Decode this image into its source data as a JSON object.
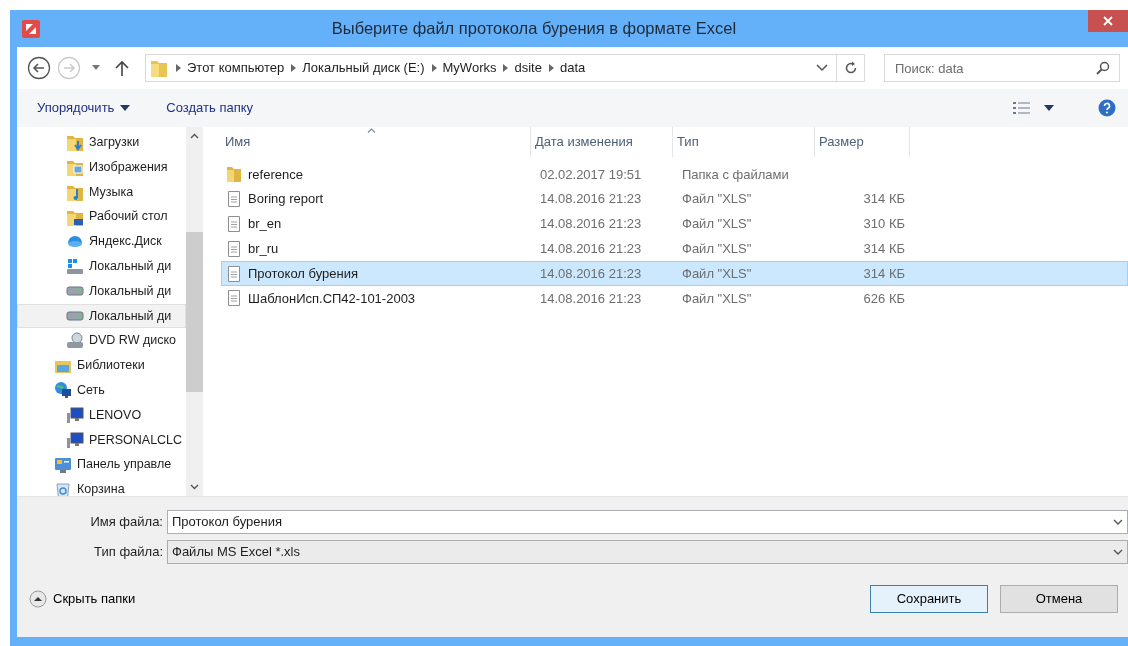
{
  "window": {
    "title": "Выберите файл протокола бурения в формате Excel"
  },
  "address_bar": {
    "path": [
      "Этот компьютер",
      "Локальный диск (E:)",
      "MyWorks",
      "dsite",
      "data"
    ]
  },
  "search": {
    "placeholder": "Поиск: data"
  },
  "toolbar": {
    "organize": "Упорядочить",
    "new_folder": "Создать папку"
  },
  "sidebar": {
    "partial_branch": [
      {
        "label": "Загрузки",
        "kind": "downloads",
        "selected": false
      },
      {
        "label": "Изображения",
        "kind": "pictures",
        "selected": false
      },
      {
        "label": "Музыка",
        "kind": "music",
        "selected": false
      },
      {
        "label": "Рабочий стол",
        "kind": "desktop",
        "selected": false
      },
      {
        "label": "Яндекс.Диск",
        "kind": "cloud",
        "selected": false
      },
      {
        "label": "Локальный ди",
        "kind": "system-drive",
        "selected": false
      },
      {
        "label": "Локальный ди",
        "kind": "drive",
        "selected": false
      },
      {
        "label": "Локальный ди",
        "kind": "drive",
        "selected": true
      },
      {
        "label": "DVD RW диско",
        "kind": "dvd",
        "selected": false
      }
    ],
    "items": [
      {
        "label": "Библиотеки",
        "kind": "libraries",
        "selected": false
      },
      {
        "label": "Сеть",
        "kind": "network",
        "selected": false,
        "children": [
          {
            "label": "LENOVO",
            "kind": "computer",
            "selected": false
          },
          {
            "label": "PERSONALCLC",
            "kind": "computer",
            "selected": false
          }
        ]
      },
      {
        "label": "Панель управле",
        "kind": "control-panel",
        "selected": false
      },
      {
        "label": "Корзина",
        "kind": "recycle-bin",
        "selected": false
      }
    ]
  },
  "file_list": {
    "columns": [
      "Имя",
      "Дата изменения",
      "Тип",
      "Размер"
    ],
    "rows": [
      {
        "name": "reference",
        "kind": "folder",
        "date": "02.02.2017 19:51",
        "type": "Папка с файлами",
        "selected": false
      },
      {
        "name": "Boring report",
        "kind": "file",
        "date": "14.08.2016 21:23",
        "type": "Файл \"XLS\"",
        "size": "314 КБ",
        "selected": false
      },
      {
        "name": "br_en",
        "kind": "file",
        "date": "14.08.2016 21:23",
        "type": "Файл \"XLS\"",
        "size": "310 КБ",
        "selected": false
      },
      {
        "name": "br_ru",
        "kind": "file",
        "date": "14.08.2016 21:23",
        "type": "Файл \"XLS\"",
        "size": "314 КБ",
        "selected": false
      },
      {
        "name": "Протокол бурения",
        "kind": "file",
        "date": "14.08.2016 21:23",
        "type": "Файл \"XLS\"",
        "size": "314 КБ",
        "selected": true
      },
      {
        "name": "ШаблонИсп.СП42-101-2003",
        "kind": "file",
        "date": "14.08.2016 21:23",
        "type": "Файл \"XLS\"",
        "size": "626 КБ",
        "selected": false
      }
    ]
  },
  "file_name": {
    "label": "Имя файла:",
    "value": "Протокол бурения"
  },
  "file_type": {
    "label": "Тип файла:",
    "value": "Файлы MS Excel *.xls"
  },
  "hide_folders": "Скрыть папки",
  "buttons": [
    {
      "label": "Сохранить",
      "kind": "primary"
    },
    {
      "label": "Отмена",
      "kind": "secondary"
    }
  ]
}
